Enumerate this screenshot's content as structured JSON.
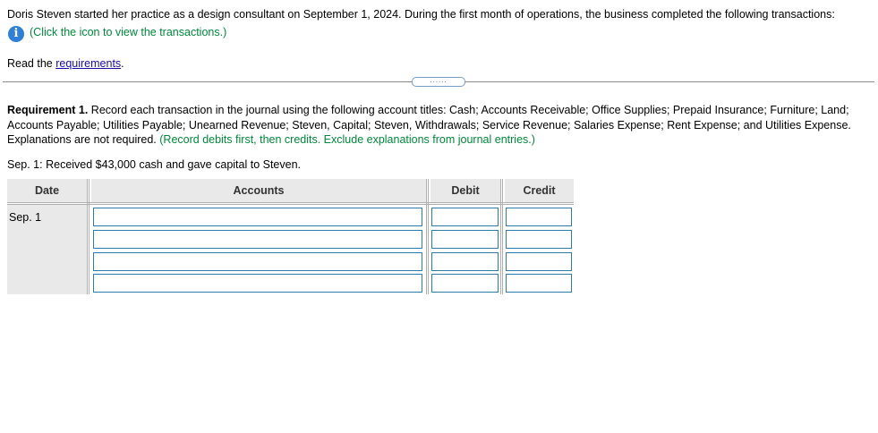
{
  "intro": {
    "text": "Doris Steven started her practice as a design consultant on September 1, 2024. During the first month of operations, the business completed the following transactions:",
    "info_link": "(Click the icon to view the transactions.)"
  },
  "read": {
    "prefix": "Read the ",
    "link": "requirements",
    "suffix": "."
  },
  "expand_dots": "......",
  "requirement": {
    "label": "Requirement 1.",
    "text": " Record each transaction in the journal using the following account titles: Cash; Accounts Receivable; Office Supplies; Prepaid Insurance; Furniture; Land; Accounts Payable; Utilities Payable; Unearned Revenue; Steven, Capital; Steven, Withdrawals; Service Revenue; Salaries Expense; Rent Expense; and Utilities Expense. Explanations are not required.",
    "note": "(Record debits first, then credits. Exclude explanations from journal entries.)"
  },
  "transaction": "Sep. 1: Received $43,000 cash and gave capital to Steven.",
  "journal": {
    "headers": {
      "date": "Date",
      "accounts": "Accounts",
      "debit": "Debit",
      "credit": "Credit"
    },
    "date_value": "Sep. 1",
    "rows": [
      {
        "account": "",
        "debit": "",
        "credit": ""
      },
      {
        "account": "",
        "debit": "",
        "credit": ""
      },
      {
        "account": "",
        "debit": "",
        "credit": ""
      },
      {
        "account": "",
        "debit": "",
        "credit": ""
      }
    ]
  },
  "colors": {
    "green_instruction": "#00883a",
    "link": "#1a0dab",
    "info_icon": "#2f7fd6",
    "input_border": "#2e7aa8"
  }
}
